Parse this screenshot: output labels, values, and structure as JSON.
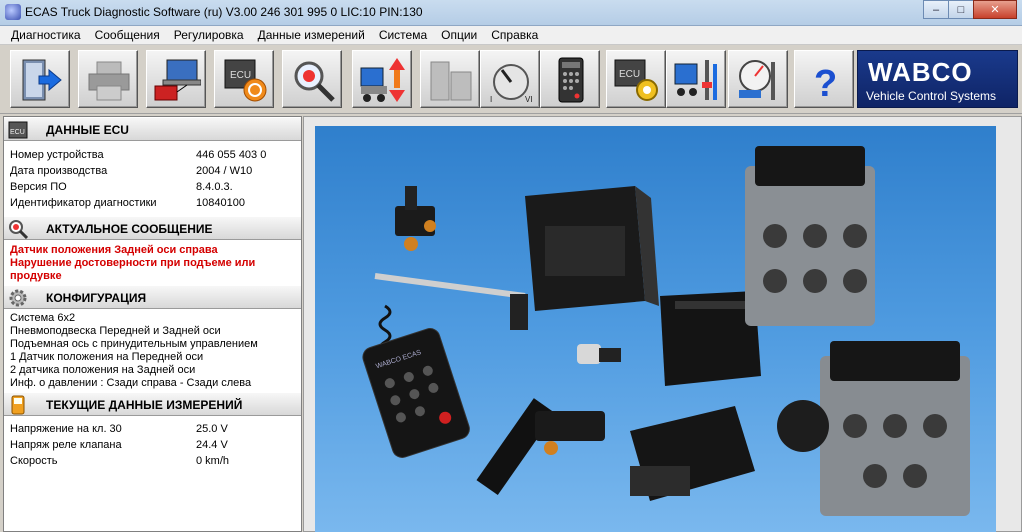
{
  "window": {
    "title": "ECAS Truck Diagnostic Software (ru) V3.00   246 301 995 0  LIC:10 PIN:130",
    "min_icon": "minimize-icon",
    "max_icon": "maximize-icon",
    "close_icon": "close-icon"
  },
  "menu": {
    "items": [
      "Диагностика",
      "Сообщения",
      "Регулировка",
      "Данные измерений",
      "Система",
      "Опции",
      "Справка"
    ]
  },
  "toolbar": {
    "buttons": [
      "exit-door-icon",
      "printer-icon",
      "laptop-ecu-icon",
      "ecu-reset-icon",
      "magnifier-icon",
      "truck-level-icon",
      "blank-panels-icon",
      "dial-icon",
      "remote-control-icon",
      "ecu-gear-icon",
      "calibration-icon",
      "pressure-gauge-icon",
      "help-icon"
    ],
    "help_label": "?",
    "brand": "WABCO",
    "brand_sub": "Vehicle Control Systems"
  },
  "ecu_data": {
    "title": "ДАННЫЕ ECU",
    "icon_text": "ECU",
    "rows": [
      {
        "label": "Номер устройства",
        "value": "446 055 403 0"
      },
      {
        "label": "Дата производства",
        "value": "2004 / W10"
      },
      {
        "label": "Версия ПО",
        "value": "8.4.0.3."
      },
      {
        "label": "Идентификатор диагностики",
        "value": "10840100"
      }
    ]
  },
  "current_message": {
    "title": "АКТУАЛЬНОЕ СООБЩЕНИЕ",
    "lines": [
      "Датчик положения Задней оси справа",
      "Нарушение достоверности при подъеме или продувке"
    ]
  },
  "configuration": {
    "title": "КОНФИГУРАЦИЯ",
    "lines": [
      "Система 6x2",
      "Пневмоподвеска Передней и Задней оси",
      "Подъемная ось с принудительным управлением",
      "1 Датчик положения на Передней оси",
      "2 датчика положения на Задней оси",
      "Инф. о давлении : Сзади справа - Сзади слева"
    ]
  },
  "measurements": {
    "title": "ТЕКУЩИЕ ДАННЫЕ ИЗМЕРЕНИЙ",
    "rows": [
      {
        "label": "Напряжение на кл. 30",
        "value": "25.0 V"
      },
      {
        "label": "Напряж реле клапана",
        "value": "24.4 V"
      },
      {
        "label": "Скорость",
        "value": "0 km/h"
      }
    ]
  },
  "product_photo": {
    "remote_label": "WABCO ECAS"
  },
  "colors": {
    "message_red": "#d40000",
    "wabco_blue": "#1a3a8c",
    "photo_blue": "#4f9be0"
  }
}
